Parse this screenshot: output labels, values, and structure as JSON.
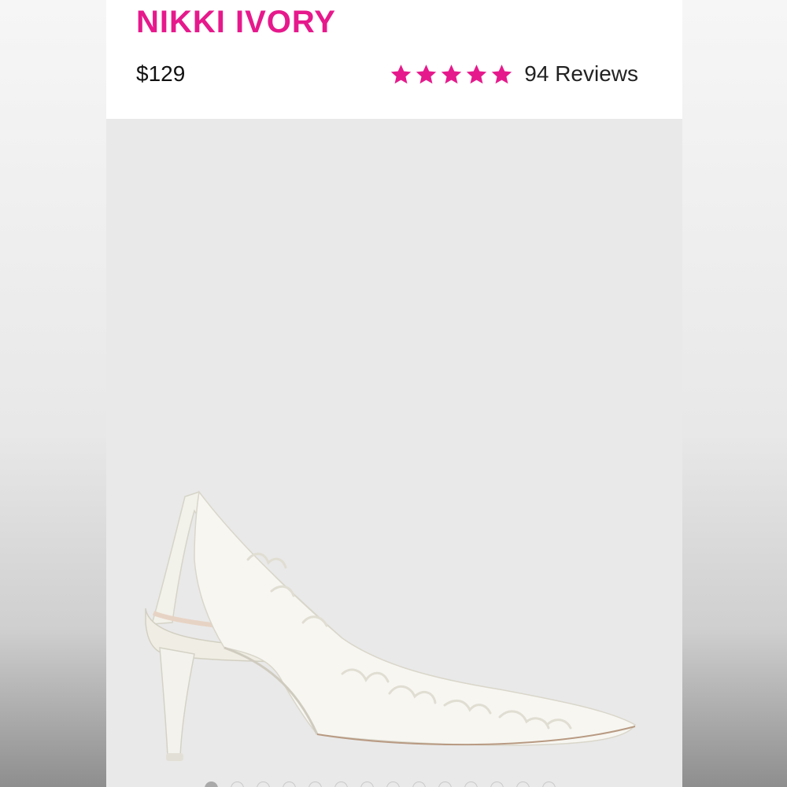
{
  "product": {
    "name": "NIKKI IVORY",
    "price": "$129",
    "rating_value": 5,
    "rating_max": 5,
    "reviews_label": "94 Reviews"
  },
  "colors": {
    "accent": "#e6198c",
    "gallery_bg": "#e9e9e9",
    "text": "#111111"
  },
  "icons": {
    "star": "star-icon"
  },
  "gallery": {
    "image_name": "shoe-image",
    "slide_count": 14,
    "active_slide": 1
  }
}
